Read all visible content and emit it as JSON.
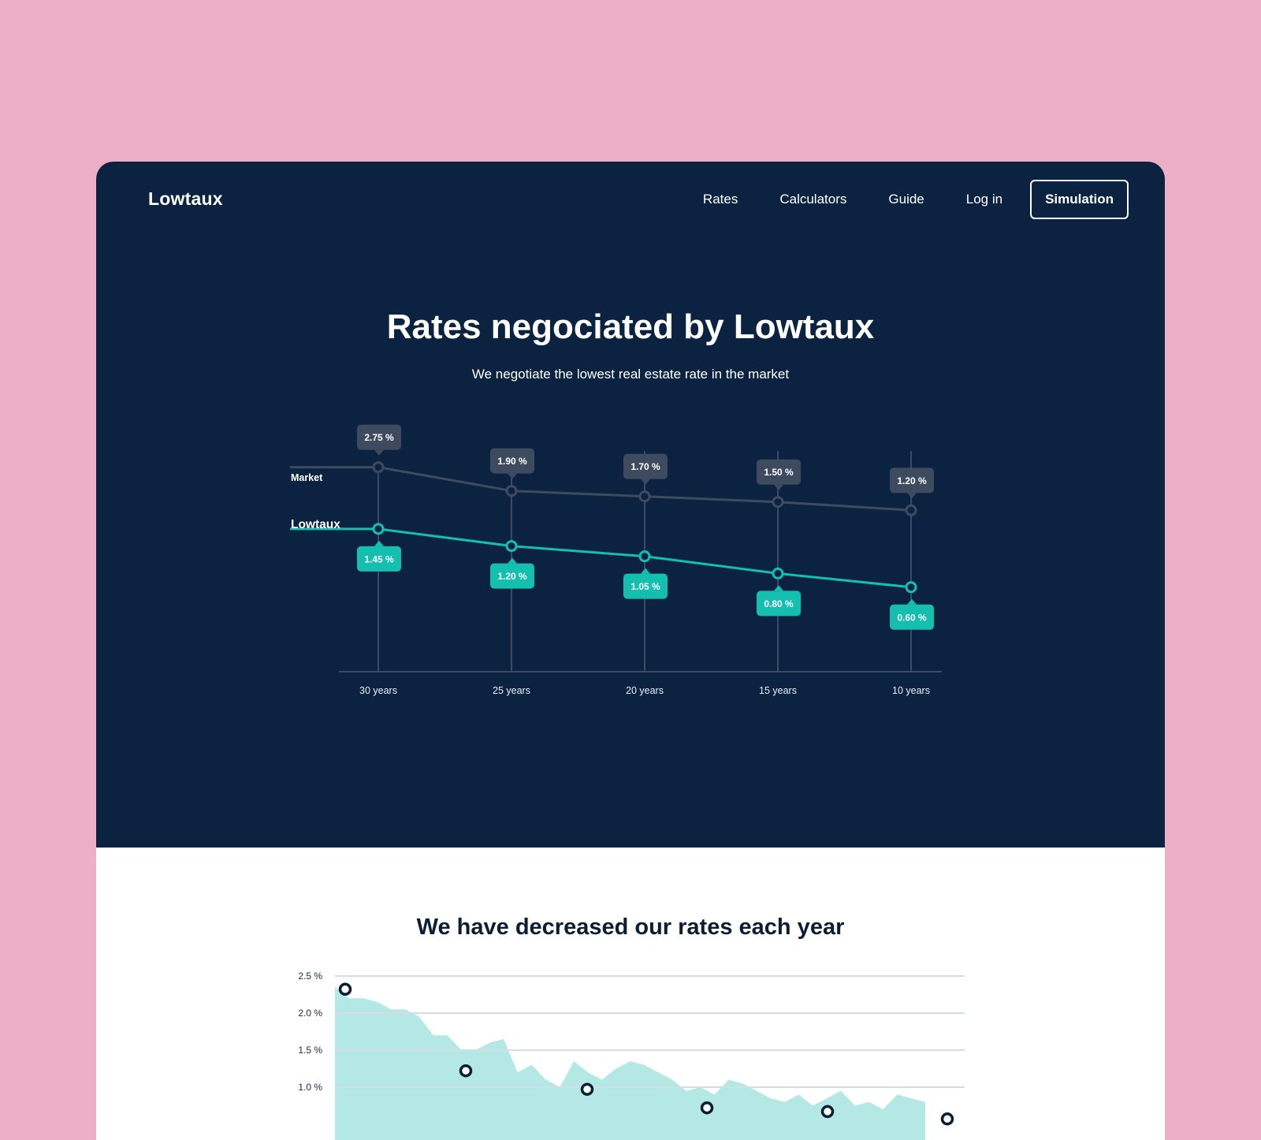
{
  "brand": {
    "name": "Lowtaux"
  },
  "nav": {
    "items": [
      "Rates",
      "Calculators",
      "Guide",
      "Log in"
    ],
    "cta": "Simulation"
  },
  "hero": {
    "title": "Rates negociated by Lowtaux",
    "subtitle": "We negotiate the lowest real estate rate in the market"
  },
  "section2": {
    "title": "We have decreased our rates each year"
  },
  "colors": {
    "page_background": "#EDAFC6",
    "hero_background": "#0B2341",
    "market": "#3E4A5E",
    "lowtaux": "#14BFB0",
    "area_fill": "#B3E8E4"
  },
  "chart_data": [
    {
      "type": "line",
      "categories": [
        "30 years",
        "25 years",
        "20 years",
        "15 years",
        "10 years"
      ],
      "series": [
        {
          "name": "Market",
          "values": [
            2.75,
            1.9,
            1.7,
            1.5,
            1.2
          ],
          "labels": [
            "2.75 %",
            "1.90 %",
            "1.70 %",
            "1.50 %",
            "1.20 %"
          ]
        },
        {
          "name": "Lowtaux",
          "values": [
            1.45,
            1.2,
            1.05,
            0.8,
            0.6
          ],
          "labels": [
            "1.45 %",
            "1.20 %",
            "1.05 %",
            "0.80 %",
            "0.60 %"
          ]
        }
      ]
    },
    {
      "type": "area",
      "yticks": [
        "2.5 %",
        "2.0 %",
        "1.5 %",
        "1.0 %"
      ],
      "ylim": [
        0,
        2.5
      ],
      "grid": true,
      "area_values": [
        2.35,
        2.2,
        2.2,
        2.15,
        2.05,
        2.05,
        1.95,
        1.7,
        1.7,
        1.5,
        1.5,
        1.6,
        1.65,
        1.2,
        1.3,
        1.1,
        1.0,
        1.35,
        1.2,
        1.1,
        1.25,
        1.35,
        1.3,
        1.2,
        1.1,
        0.95,
        1.0,
        0.9,
        1.1,
        1.05,
        0.95,
        0.85,
        0.8,
        0.9,
        0.75,
        0.85,
        0.95,
        0.75,
        0.8,
        0.7,
        0.9,
        0.85,
        0.8
      ],
      "points": [
        2.3,
        1.2,
        0.95,
        0.7,
        0.65,
        0.55
      ]
    }
  ]
}
